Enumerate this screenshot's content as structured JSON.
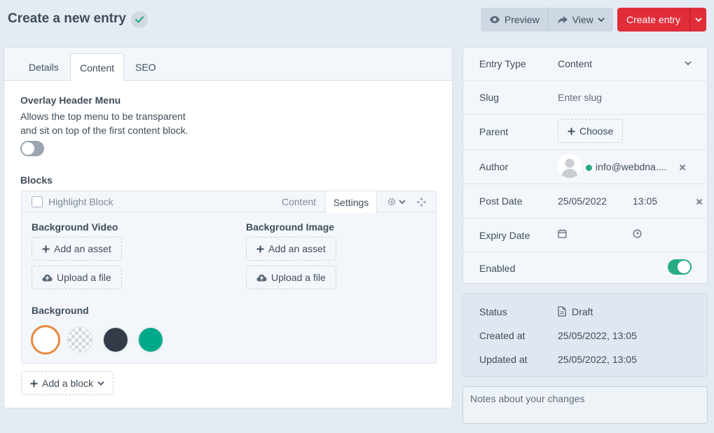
{
  "header": {
    "title": "Create a new entry",
    "preview_label": "Preview",
    "view_label": "View",
    "create_label": "Create entry"
  },
  "tabs": [
    {
      "label": "Details"
    },
    {
      "label": "Content"
    },
    {
      "label": "SEO"
    }
  ],
  "overlay": {
    "heading": "Overlay Header Menu",
    "instructions_line1": "Allows the top menu to be transparent",
    "instructions_line2": "and sit on top of the first content block."
  },
  "blocks": {
    "heading": "Blocks",
    "block_title": "Highlight Block",
    "tab_content": "Content",
    "tab_settings": "Settings",
    "bg_video_heading": "Background Video",
    "bg_image_heading": "Background Image",
    "add_asset_label": "Add an asset",
    "upload_label": "Upload a file",
    "background_heading": "Background",
    "add_block_label": "Add a block",
    "swatch_colors": [
      "#ffffff",
      "transparent",
      "#333a48",
      "#00a98a"
    ],
    "selected_swatch_border": "#e7893e"
  },
  "meta": {
    "entry_type_label": "Entry Type",
    "entry_type_value": "Content",
    "slug_label": "Slug",
    "slug_placeholder": "Enter slug",
    "parent_label": "Parent",
    "choose_label": "Choose",
    "author_label": "Author",
    "author_value": "info@webdna....",
    "post_date_label": "Post Date",
    "post_date_value": "25/05/2022",
    "post_time_value": "13:05",
    "expiry_date_label": "Expiry Date",
    "enabled_label": "Enabled"
  },
  "status": {
    "status_label": "Status",
    "status_value": "Draft",
    "created_label": "Created at",
    "created_value": "25/05/2022, 13:05",
    "updated_label": "Updated at",
    "updated_value": "25/05/2022, 13:05"
  },
  "notes": {
    "placeholder": "Notes about your changes"
  },
  "colors": {
    "accent_red": "#e12d39",
    "enabled_green": "#27ab83",
    "status_dot": "#27ab83"
  }
}
